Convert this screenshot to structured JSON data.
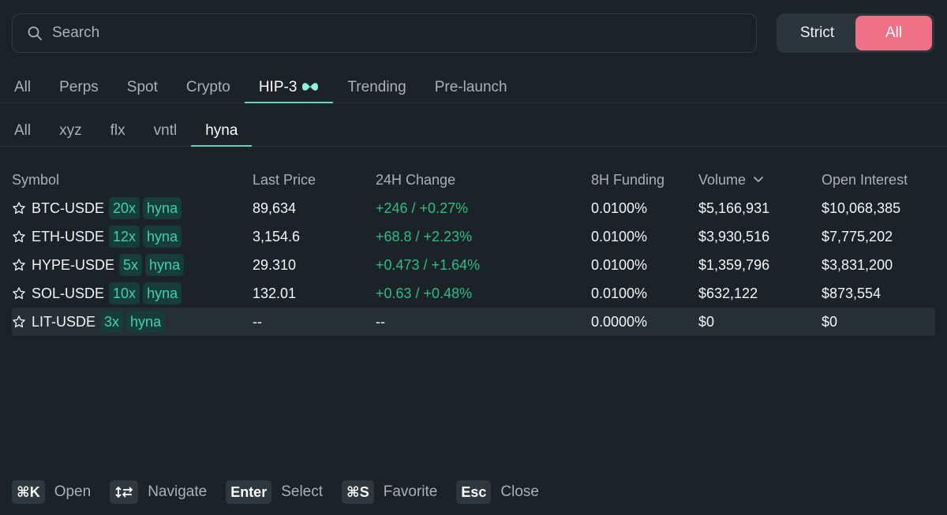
{
  "search": {
    "placeholder": "Search"
  },
  "toggle": {
    "strict": "Strict",
    "all": "All"
  },
  "main_tabs": [
    "All",
    "Perps",
    "Spot",
    "Crypto",
    "HIP-3",
    "Trending",
    "Pre-launch"
  ],
  "sub_tabs": [
    "All",
    "xyz",
    "flx",
    "vntl",
    "hyna"
  ],
  "table": {
    "headers": {
      "symbol": "Symbol",
      "last_price": "Last Price",
      "change": "24H Change",
      "funding": "8H Funding",
      "volume": "Volume",
      "open_interest": "Open Interest"
    },
    "rows": [
      {
        "symbol": "BTC-USDE",
        "leverage": "20x",
        "dex": "hyna",
        "price": "89,634",
        "change": "+246 / +0.27%",
        "funding": "0.0100%",
        "volume": "$5,166,931",
        "oi": "$10,068,385"
      },
      {
        "symbol": "ETH-USDE",
        "leverage": "12x",
        "dex": "hyna",
        "price": "3,154.6",
        "change": "+68.8 / +2.23%",
        "funding": "0.0100%",
        "volume": "$3,930,516",
        "oi": "$7,775,202"
      },
      {
        "symbol": "HYPE-USDE",
        "leverage": "5x",
        "dex": "hyna",
        "price": "29.310",
        "change": "+0.473 / +1.64%",
        "funding": "0.0100%",
        "volume": "$1,359,796",
        "oi": "$3,831,200"
      },
      {
        "symbol": "SOL-USDE",
        "leverage": "10x",
        "dex": "hyna",
        "price": "132.01",
        "change": "+0.63 / +0.48%",
        "funding": "0.0100%",
        "volume": "$632,122",
        "oi": "$873,554"
      },
      {
        "symbol": "LIT-USDE",
        "leverage": "3x",
        "dex": "hyna",
        "price": "--",
        "change": "--",
        "funding": "0.0000%",
        "volume": "$0",
        "oi": "$0"
      }
    ]
  },
  "footer": {
    "open_key": "⌘K",
    "open_label": "Open",
    "navigate_label": "Navigate",
    "select_key": "Enter",
    "select_label": "Select",
    "favorite_key": "⌘S",
    "favorite_label": "Favorite",
    "close_key": "Esc",
    "close_label": "Close"
  },
  "colors": {
    "background": "#1b2329",
    "accent": "#5fd6c0",
    "positive": "#2cbd85",
    "toggle_active": "#ef7186",
    "badge_bg": "#173d3a",
    "badge_text": "#3fd0ad"
  },
  "icons": {
    "search": "search-icon",
    "hip3": "hyperliquid-logo-icon",
    "favorite": "star-icon",
    "sort": "chevron-down-icon",
    "navigate": "arrows-icon"
  }
}
